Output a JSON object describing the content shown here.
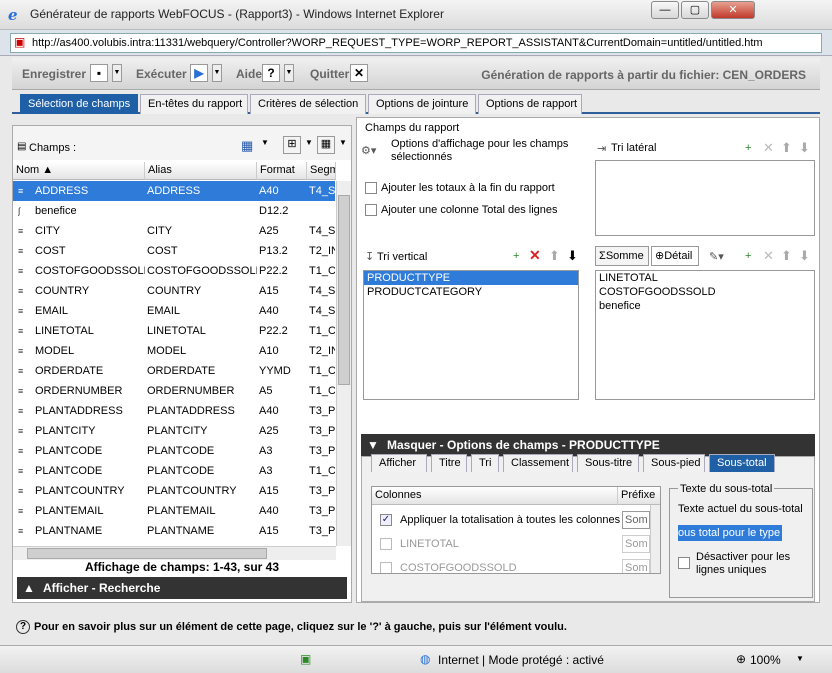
{
  "window": {
    "title": "Générateur de rapports WebFOCUS - (Rapport3) - Windows Internet Explorer",
    "min": "—",
    "max": "▢",
    "close": "✕"
  },
  "browser": {
    "url": "http://as400.volubis.intra:11331/webquery/Controller?WORP_REQUEST_TYPE=WORP_REPORT_ASSISTANT&CurrentDomain=untitled/untitled.htm"
  },
  "toolbar": {
    "save": "Enregistrer",
    "run": "Exécuter",
    "help": "Aide",
    "quit": "Quitter",
    "source": "Génération de rapports à partir du fichier: CEN_ORDERS"
  },
  "tabs": [
    "Sélection de champs",
    "En-têtes du rapport",
    "Critères de sélection",
    "Options de jointure",
    "Options de rapport"
  ],
  "fields_panel": {
    "label": "Champs :",
    "columns": [
      "Nom",
      "Alias",
      "Format",
      "Segment"
    ],
    "rows": [
      {
        "name": "ADDRESS",
        "alias": "ADDRESS",
        "format": "A40",
        "segment": "T4_S"
      },
      {
        "name": "benefice",
        "alias": "",
        "format": "D12.2",
        "segment": ""
      },
      {
        "name": "CITY",
        "alias": "CITY",
        "format": "A25",
        "segment": "T4_S"
      },
      {
        "name": "COST",
        "alias": "COST",
        "format": "P13.2",
        "segment": "T2_IN"
      },
      {
        "name": "COSTOFGOODSSOLD",
        "alias": "COSTOFGOODSSOLD",
        "format": "P22.2",
        "segment": "T1_C"
      },
      {
        "name": "COUNTRY",
        "alias": "COUNTRY",
        "format": "A15",
        "segment": "T4_S"
      },
      {
        "name": "EMAIL",
        "alias": "EMAIL",
        "format": "A40",
        "segment": "T4_S"
      },
      {
        "name": "LINETOTAL",
        "alias": "LINETOTAL",
        "format": "P22.2",
        "segment": "T1_C"
      },
      {
        "name": "MODEL",
        "alias": "MODEL",
        "format": "A10",
        "segment": "T2_IN"
      },
      {
        "name": "ORDERDATE",
        "alias": "ORDERDATE",
        "format": "YYMD",
        "segment": "T1_C"
      },
      {
        "name": "ORDERNUMBER",
        "alias": "ORDERNUMBER",
        "format": "A5",
        "segment": "T1_C"
      },
      {
        "name": "PLANTADDRESS",
        "alias": "PLANTADDRESS",
        "format": "A40",
        "segment": "T3_P"
      },
      {
        "name": "PLANTCITY",
        "alias": "PLANTCITY",
        "format": "A25",
        "segment": "T3_P"
      },
      {
        "name": "PLANTCODE",
        "alias": "PLANTCODE",
        "format": "A3",
        "segment": "T3_P"
      },
      {
        "name": "PLANTCODE",
        "alias": "PLANTCODE",
        "format": "A3",
        "segment": "T1_C"
      },
      {
        "name": "PLANTCOUNTRY",
        "alias": "PLANTCOUNTRY",
        "format": "A15",
        "segment": "T3_P"
      },
      {
        "name": "PLANTEMAIL",
        "alias": "PLANTEMAIL",
        "format": "A40",
        "segment": "T3_P"
      },
      {
        "name": "PLANTNAME",
        "alias": "PLANTNAME",
        "format": "A15",
        "segment": "T3_P"
      }
    ],
    "count": "Affichage de champs: 1-43, sur 43",
    "search": "Afficher - Recherche"
  },
  "report_fields": {
    "title": "Champs du rapport",
    "display_options": "Options d'affichage pour les champs sélectionnés",
    "add_totals": "Ajouter les totaux à la fin du rapport",
    "add_total_col": "Ajouter une colonne Total des lignes",
    "side_sort": "Tri latéral",
    "vertical_sort": "Tri vertical",
    "vertical_items": [
      "PRODUCTTYPE",
      "PRODUCTCATEGORY"
    ],
    "sum_tab": "Somme",
    "detail_tab": "Détail",
    "sum_items": [
      "LINETOTAL",
      "COSTOFGOODSSOLD",
      "benefice"
    ]
  },
  "field_options": {
    "header": "Masquer - Options de champs - PRODUCTTYPE",
    "tabs": [
      "Afficher",
      "Titre",
      "Tri",
      "Classement",
      "Sous-titre",
      "Sous-pied",
      "Sous-total"
    ],
    "col_header": "Colonnes",
    "prefix_header": "Préfixe",
    "apply_all": "Appliquer la totalisation à toutes les colonnes",
    "items": [
      "LINETOTAL",
      "COSTOFGOODSSOLD"
    ],
    "prefix_value": "Som",
    "subtotal_group": "Texte du sous-total",
    "current_text_label": "Texte actuel du sous-total",
    "current_text_value": "ous total pour le type",
    "disable_unique": "Désactiver pour les lignes uniques"
  },
  "help_text": "Pour en savoir plus sur un élément de cette page, cliquez sur le '?' à gauche, puis sur l'élément voulu.",
  "statusbar": {
    "zone": "Internet | Mode protégé : activé",
    "zoom": "100%"
  }
}
